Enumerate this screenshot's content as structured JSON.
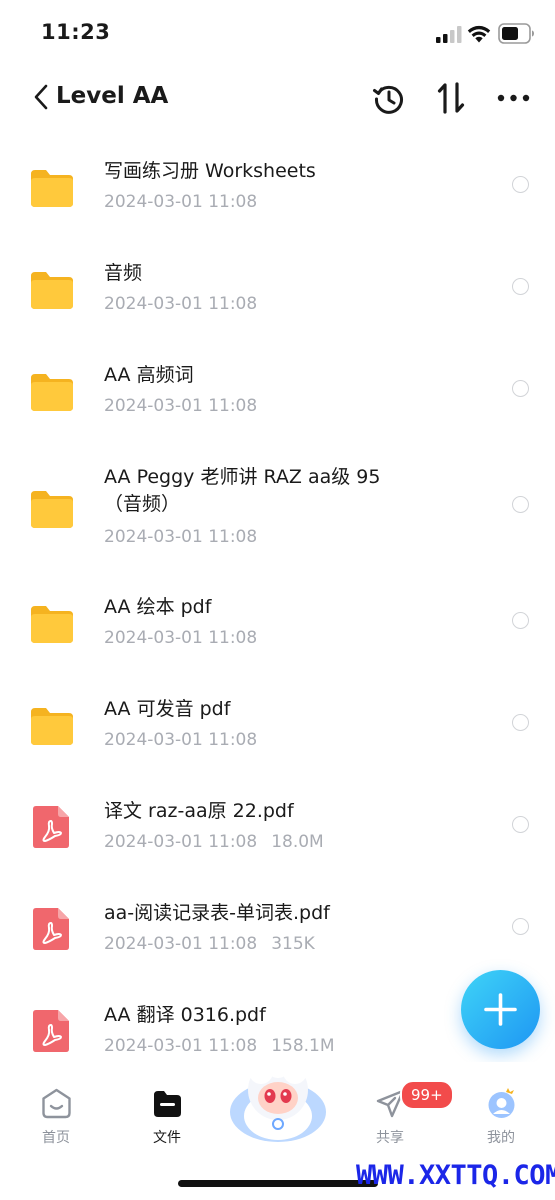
{
  "status_bar": {
    "time": "11:23"
  },
  "nav": {
    "title": "Level AA"
  },
  "files": [
    {
      "name": "写画练习册 Worksheets",
      "date": "2024-03-01 11:08",
      "size": "",
      "type": "folder"
    },
    {
      "name": "音频",
      "date": "2024-03-01 11:08",
      "size": "",
      "type": "folder"
    },
    {
      "name": "AA 高频词",
      "date": "2024-03-01 11:08",
      "size": "",
      "type": "folder"
    },
    {
      "name": "AA Peggy 老师讲 RAZ aa级 95\n（音频）",
      "date": "2024-03-01 11:08",
      "size": "",
      "type": "folder"
    },
    {
      "name": "AA 绘本 pdf",
      "date": "2024-03-01 11:08",
      "size": "",
      "type": "folder"
    },
    {
      "name": "AA 可发音 pdf",
      "date": "2024-03-01 11:08",
      "size": "",
      "type": "folder"
    },
    {
      "name": "译文 raz-aa原 22.pdf",
      "date": "2024-03-01 11:08",
      "size": "18.0M",
      "type": "pdf"
    },
    {
      "name": "aa-阅读记录表-单词表.pdf",
      "date": "2024-03-01 11:08",
      "size": "315K",
      "type": "pdf"
    },
    {
      "name": "AA 翻译 0316.pdf",
      "date": "2024-03-01 11:08",
      "size": "158.1M",
      "type": "pdf"
    }
  ],
  "tabs": {
    "home": "首页",
    "files": "文件",
    "share": "共享",
    "mine": "我的",
    "share_badge": "99+"
  },
  "watermark": "WWW.XXTTQ.COM",
  "colors": {
    "accent": "#1e96f3",
    "folder": "#ffc93c",
    "pdf": "#f0676d",
    "badge": "#f24b4b"
  }
}
